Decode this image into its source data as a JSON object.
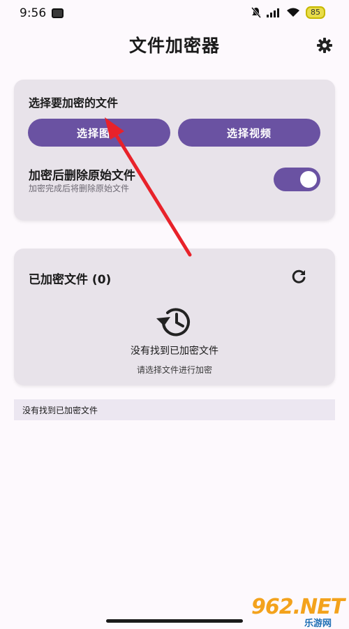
{
  "status_bar": {
    "time": "9:56",
    "battery": "85"
  },
  "header": {
    "title": "文件加密器",
    "settings_icon": "gear-icon"
  },
  "select_card": {
    "title": "选择要加密的文件",
    "select_image_label": "选择图片",
    "select_video_label": "选择视频",
    "delete_option_title": "加密后删除原始文件",
    "delete_option_desc": "加密完成后将删除原始文件",
    "delete_option_enabled": true
  },
  "encrypted_card": {
    "title": "已加密文件 (0)",
    "refresh_icon": "refresh-icon",
    "empty_icon": "history-icon",
    "empty_text": "没有找到已加密文件",
    "empty_sub": "请选择文件进行加密"
  },
  "bottom_message": "没有找到已加密文件",
  "watermark": {
    "brand": "962.NET",
    "sub": "乐游网"
  },
  "colors": {
    "accent": "#6a52a2",
    "card_bg": "#e8e3ea",
    "page_bg": "#fdf9fd",
    "arrow": "#e8222a"
  }
}
